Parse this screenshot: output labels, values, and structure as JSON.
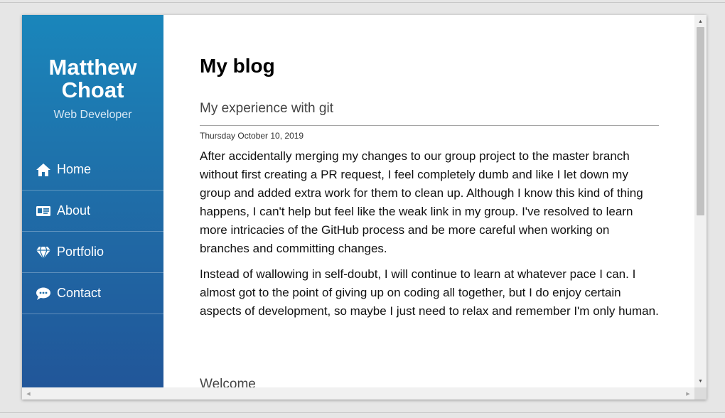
{
  "sidebar": {
    "name_line1": "Matthew",
    "name_line2": "Choat",
    "subtitle": "Web Developer",
    "nav": [
      {
        "label": "Home",
        "icon": "home-icon"
      },
      {
        "label": "About",
        "icon": "id-card-icon"
      },
      {
        "label": "Portfolio",
        "icon": "gem-icon"
      },
      {
        "label": "Contact",
        "icon": "comment-icon"
      }
    ]
  },
  "main": {
    "page_title": "My blog",
    "post": {
      "title": "My experience with git",
      "date": "Thursday October 10, 2019",
      "paragraphs": [
        "After accidentally merging my changes to our group project to the master branch without first creating a PR request, I feel completely dumb and like I let down my group and added extra work for them to clean up. Although I know this kind of thing happens, I can't help but feel like the weak link in my group. I've resolved to learn more intricacies of the GitHub process and be more careful when working on branches and committing changes.",
        "Instead of wallowing in self-doubt, I will continue to learn at whatever pace I can. I almost got to the point of giving up on coding all together, but I do enjoy certain aspects of development, so maybe I just need to relax and remember I'm only human."
      ]
    },
    "next_post_title": "Welcome"
  },
  "scrollbars": {
    "up_arrow": "▲",
    "down_arrow": "▼",
    "left_arrow": "◀",
    "right_arrow": "▶"
  },
  "colors": {
    "sidebar_top": "#1a86bb",
    "sidebar_bottom": "#215699"
  }
}
